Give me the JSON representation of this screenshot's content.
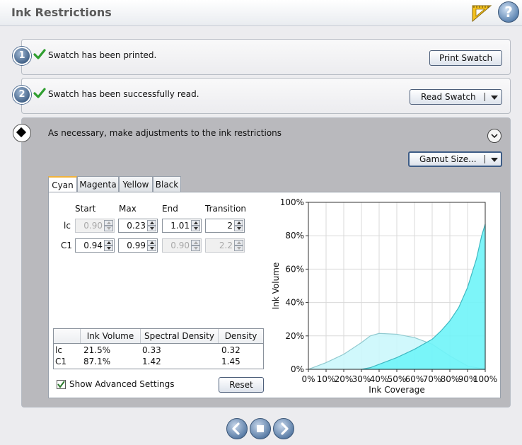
{
  "header": {
    "title": "Ink Restrictions",
    "ruler_icon": "ruler-icon",
    "help_icon": "help-icon",
    "help_glyph": "?"
  },
  "steps": [
    {
      "number": "1",
      "text": "Swatch has been printed.",
      "button": "Print Swatch"
    },
    {
      "number": "2",
      "text": "Swatch has been successfully read.",
      "button": "Read Swatch"
    },
    {
      "text": "As necessary, make adjustments to the ink restrictions",
      "button": "Gamut Size..."
    }
  ],
  "tabs": [
    "Cyan",
    "Magenta",
    "Yellow",
    "Black"
  ],
  "restrictions": {
    "headers": [
      "Start",
      "Max",
      "End",
      "Transition"
    ],
    "rows": [
      {
        "label": "lc",
        "start": "0.90",
        "max": "0.23",
        "end": "1.01",
        "transition": "2"
      },
      {
        "label": "C1",
        "start": "0.94",
        "max": "0.99",
        "end": "0.90",
        "transition": "2.2"
      }
    ]
  },
  "summary_table": {
    "headers": [
      "",
      "Ink Volume",
      "Spectral Density",
      "Density"
    ],
    "rows": [
      [
        "lc",
        "21.5%",
        "0.33",
        "0.32"
      ],
      [
        "C1",
        "87.1%",
        "1.42",
        "1.45"
      ]
    ]
  },
  "show_advanced_label": "Show Advanced Settings",
  "show_advanced_checked": true,
  "reset_label": "Reset",
  "colors": {
    "curve_lc": "#c8f7fb",
    "curve_c1": "#6ff4f8",
    "accent": "#4b6a90",
    "tab_active": "#f1b33d"
  },
  "chart_data": {
    "type": "area",
    "xlabel": "Ink Coverage",
    "ylabel": "Ink Volume",
    "xlim": [
      0,
      100
    ],
    "ylim": [
      0,
      100
    ],
    "xticks": [
      "0%",
      "10%",
      "20%",
      "30%",
      "40%",
      "50%",
      "60%",
      "70%",
      "80%",
      "90%",
      "100%"
    ],
    "yticks": [
      "0%",
      "20%",
      "40%",
      "60%",
      "80%",
      "100%"
    ],
    "grid": true,
    "series": [
      {
        "x": [
          0,
          10,
          20,
          30,
          35,
          40,
          50,
          60,
          70,
          80,
          90,
          100
        ],
        "y": [
          0,
          4,
          9,
          16,
          20,
          21.5,
          21,
          19,
          15,
          8,
          2,
          0
        ]
      },
      {
        "x": [
          30,
          35,
          40,
          50,
          60,
          70,
          75,
          80,
          85,
          90,
          95,
          98,
          100
        ],
        "y": [
          0,
          1,
          3,
          7,
          12,
          18,
          23,
          29,
          37,
          49,
          66,
          80,
          87
        ]
      }
    ]
  }
}
